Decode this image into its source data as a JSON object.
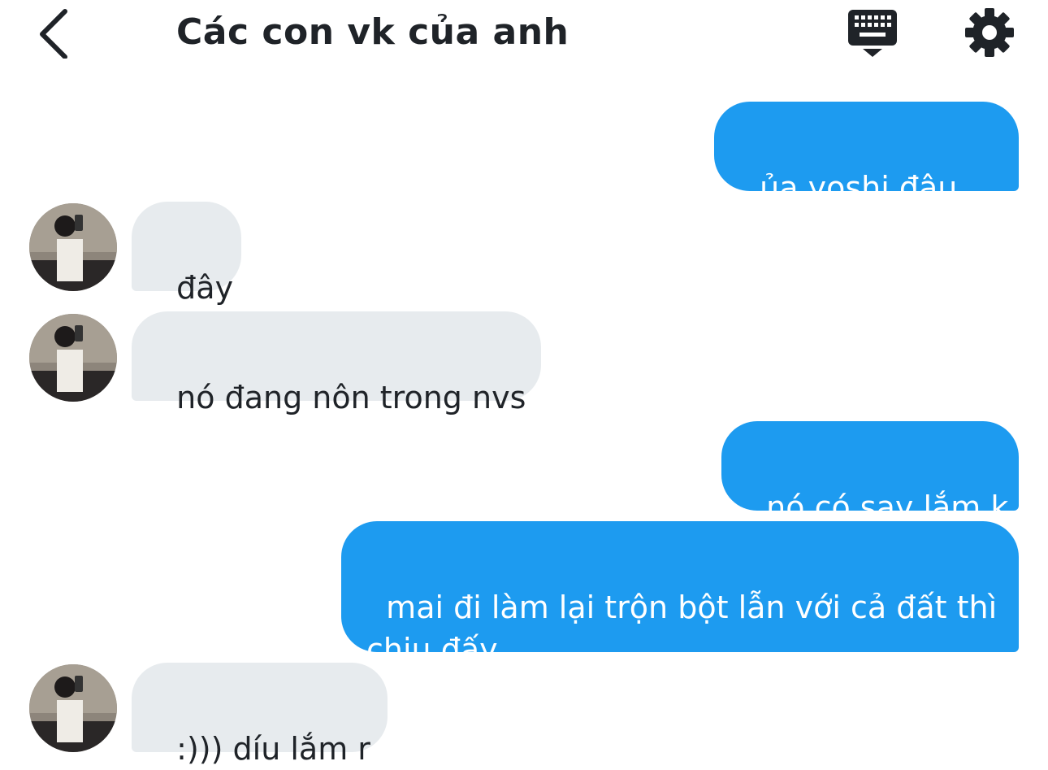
{
  "header": {
    "title": "Các con vk của anh",
    "back_icon": "chevron-left-icon",
    "keyboard_icon": "keyboard-icon",
    "settings_icon": "gear-icon"
  },
  "colors": {
    "outgoing_bubble": "#1d9bf0",
    "incoming_bubble": "#e7ebee",
    "text_dark": "#1f2328"
  },
  "messages": [
    {
      "direction": "out",
      "text": "ủa yoshi đâu rồi"
    },
    {
      "direction": "in",
      "text": "đây"
    },
    {
      "direction": "in",
      "text": "nó đang nôn trong nvs"
    },
    {
      "direction": "out",
      "text": "nó có say lắm k"
    },
    {
      "direction": "out",
      "text": "mai đi làm lại trộn bột lẫn với cả đất thì chịu đấy"
    },
    {
      "direction": "in",
      "text": ":))) díu lắm r"
    }
  ]
}
